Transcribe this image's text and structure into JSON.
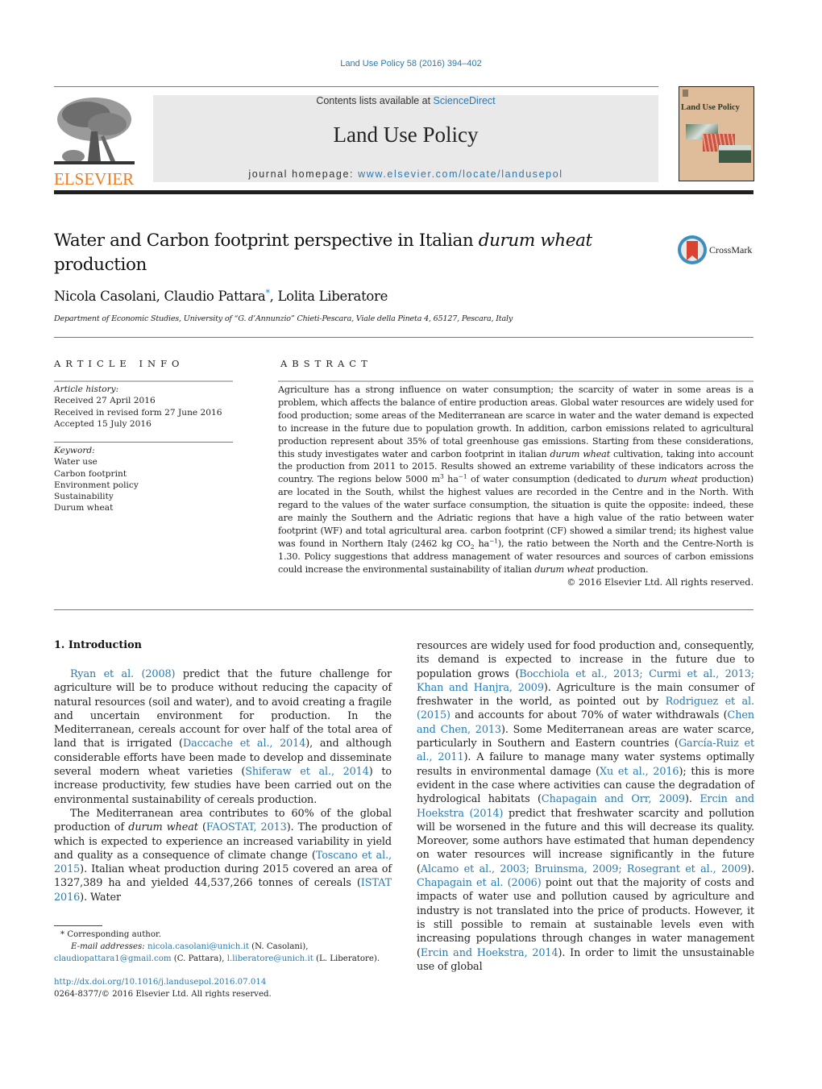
{
  "header": {
    "citation": "Land Use Policy 58 (2016) 394–402",
    "publisher_logo_text": "ELSEVIER",
    "contents_prefix": "Contents lists available at ",
    "contents_link": "ScienceDirect",
    "journal_name": "Land Use Policy",
    "homepage_prefix": "journal homepage: ",
    "homepage_link": "www.elsevier.com/locate/landusepol",
    "cover_title": "Land Use Policy",
    "crossmark_label": "CrossMark"
  },
  "article": {
    "title_part1": "Water and Carbon footprint perspective in Italian ",
    "title_italic": "durum wheat",
    "title_part2": "production",
    "authors_a": "Nicola Casolani, Claudio Pattara",
    "authors_star": "*",
    "authors_b": ", Lolita Liberatore",
    "affiliation": "Department of Economic Studies, University of “G. d’Annunzio” Chieti-Pescara, Viale della Pineta 4, 65127, Pescara, Italy"
  },
  "article_info": {
    "heading": "ARTICLE INFO",
    "history_label": "Article history:",
    "history": [
      "Received 27 April 2016",
      "Received in revised form 27 June 2016",
      "Accepted 15 July 2016"
    ],
    "keywords_label": "Keyword:",
    "keywords": [
      "Water use",
      "Carbon footprint",
      "Environment policy",
      "Sustainability",
      "Durum wheat"
    ]
  },
  "abstract": {
    "heading": "ABSTRACT",
    "t1": "Agriculture has a strong influence on water consumption; the scarcity of water in some areas is a problem, which affects the balance of entire production areas. Global water resources are widely used for food production; some areas of the Mediterranean are scarce in water and the water demand is expected to increase in the future due to population growth. In addition, carbon emissions related to agricultural production represent about 35% of total greenhouse gas emissions. Starting from these considerations, this study investigates water and carbon footprint in italian ",
    "i1": "durum wheat",
    "t2": " cultivation, taking into account the production from 2011 to 2015. Results showed an extreme variability of these indicators across the country. The regions below 5000 m",
    "sup3": "3",
    "t3": " ha",
    "supm1a": "−1",
    "t4": " of water consumption (dedicated to ",
    "i2": "durum wheat",
    "t5": " production) are located in the South, whilst the highest values are recorded in the Centre and in the North. With regard to the values of the water surface consumption, the situation is quite the opposite: indeed, these are mainly the Southern and the Adriatic regions that have a high value of the ratio between water footprint (WF) and total agricultural area. carbon footprint (CF) showed a similar trend; its highest value was found in Northern Italy (2462 kg CO",
    "sub2": "2",
    "t6": " ha",
    "supm1b": "−1",
    "t7": "), the ratio between the North and the Centre-North is 1.30. Policy suggestions that address management of water resources and sources of carbon emissions could increase the environmental sustainability of italian ",
    "i3": "durum wheat",
    "t8": " production.",
    "copyright": "© 2016 Elsevier Ltd. All rights reserved."
  },
  "intro": {
    "heading": "1.  Introduction",
    "p1": {
      "l1": "Ryan et al. (2008)",
      "t1": " predict that the future challenge for agriculture will be to produce without reducing the capacity of natural resources (soil and water), and to avoid creating a fragile and uncertain environment for production. In the Mediterranean, cereals account for over half of the total area of land that is irrigated (",
      "l2": "Daccache et al., 2014",
      "t2": "), and although considerable efforts have been made to develop and disseminate several modern wheat varieties (",
      "l3": "Shiferaw et al., 2014",
      "t3": ") to increase productivity, few studies have been carried out on the environmental sustainability of cereals production."
    },
    "p2": {
      "t1": "The Mediterranean area contributes to 60% of the global production of ",
      "i1": "durum wheat",
      "t2": " (",
      "l1": "FAOSTAT, 2013",
      "t3": "). The production of which is expected to experience an increased variability in yield and quality as a consequence of climate change (",
      "l2": "Toscano et al., 2015",
      "t4": "). Italian wheat production during 2015 covered an area of 1327,389 ha and yielded 44,537,266 tonnes of cereals (",
      "l3": "ISTAT 2016",
      "t5": "). Water"
    },
    "p3": {
      "t1": "resources are widely used for food production and, consequently, its demand is expected to increase in the future due to population grows (",
      "l1": "Bocchiola et al., 2013; Curmi et al., 2013; Khan and Hanjra, 2009",
      "t2": "). Agriculture is the main consumer of freshwater in the world, as pointed out by ",
      "l2": "Rodriguez et al. (2015)",
      "t3": " and accounts for about 70% of water withdrawals (",
      "l3": "Chen and Chen, 2013",
      "t4": "). Some Mediterranean areas are water scarce, particularly in Southern and Eastern countries (",
      "l4": "García-Ruiz et al., 2011",
      "t5": "). A failure to manage many water systems optimally results in environmental damage (",
      "l5": "Xu et al., 2016",
      "t6": "); this is more evident in the case where activities can cause the degradation of hydrological habitats (",
      "l6": "Chapagain and Orr, 2009",
      "t7": "). ",
      "l7": "Ercin and Hoekstra (2014)",
      "t8": " predict that freshwater scarcity and pollution will be worsened in the future and this will decrease its quality. Moreover, some authors have estimated that human dependency on water resources will increase significantly in the future (",
      "l8": "Alcamo et al., 2003; Bruinsma, 2009; Rosegrant et al., 2009",
      "t9": "). ",
      "l9": "Chapagain et al. (2006)",
      "t10": " point out that the majority of costs and impacts of water use and pollution caused by agriculture and industry is not translated into the price of products. However, it is still possible to remain at sustainable levels even with increasing populations through changes in water management (",
      "l10": "Ercin and Hoekstra, 2014",
      "t11": "). In order to limit the unsustainable use of global"
    }
  },
  "footnote": {
    "star_line": "* Corresponding author.",
    "email_label": "E-mail addresses: ",
    "email1": "nicola.casolani@unich.it",
    "email1_name": " (N. Casolani),",
    "email2": "claudiopattara1@gmail.com",
    "email2_name": " (C. Pattara), ",
    "email3": "l.liberatore@unich.it",
    "email3_name": " (L. Liberatore).",
    "doi": "http://dx.doi.org/10.1016/j.landusepol.2016.07.014",
    "issn": "0264-8377/© 2016 Elsevier Ltd. All rights reserved."
  },
  "colors": {
    "link": "#2a7ab0",
    "elsevier_orange": "#f07a1e",
    "banner_bg": "#e9e9e9",
    "cover_bg": "#dfbc9a"
  }
}
